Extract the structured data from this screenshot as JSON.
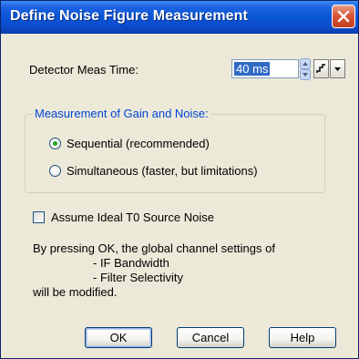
{
  "window": {
    "title": "Define Noise Figure Measurement"
  },
  "detector": {
    "label": "Detector Meas Time:",
    "value": "40 ms"
  },
  "group": {
    "title": "Measurement of Gain and Noise:",
    "options": [
      {
        "label": "Sequential (recommended)",
        "selected": true
      },
      {
        "label": "Simultaneous (faster, but limitations)",
        "selected": false
      }
    ]
  },
  "checkbox": {
    "label": "Assume Ideal T0 Source Noise",
    "checked": false
  },
  "info": {
    "lines": [
      "By pressing OK, the global channel settings of",
      "- IF Bandwidth",
      "- Filter Selectivity",
      "will be modified."
    ]
  },
  "buttons": {
    "ok": "OK",
    "cancel": "Cancel",
    "help": "Help"
  },
  "icons": {
    "close": "close-icon",
    "spin": "spin-arrows-icon",
    "step": "step-icon",
    "dropdown": "dropdown-arrow-icon"
  },
  "colors": {
    "title_bar": "#0a57d6",
    "group_title": "#0046d5",
    "selection": "#316ac5",
    "radio_dot": "#21a121",
    "dialog_bg": "#ece9d8"
  }
}
